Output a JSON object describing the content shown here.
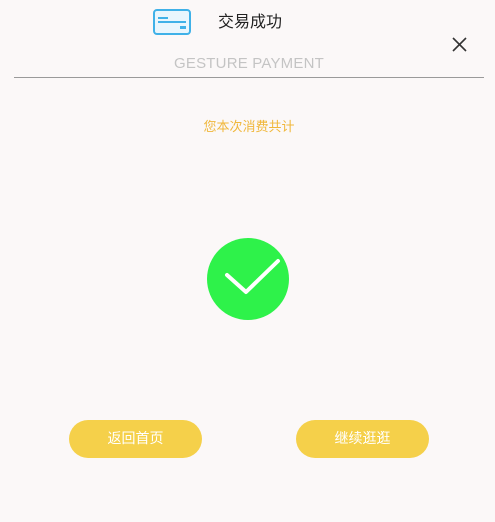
{
  "header": {
    "title": "交易成功",
    "subtitle": "GESTURE PAYMENT",
    "card_icon": "credit-card-icon",
    "close_icon": "close-icon"
  },
  "main": {
    "summary_text": "您本次消费共计",
    "status_icon": "success-check-icon"
  },
  "actions": {
    "home_label": "返回首页",
    "continue_label": "继续逛逛"
  },
  "colors": {
    "accent": "#f5d04a",
    "summary_text": "#f0b73a",
    "success": "#2ef24a",
    "card_icon": "#3fb1e8",
    "background": "#fbf8f8"
  }
}
